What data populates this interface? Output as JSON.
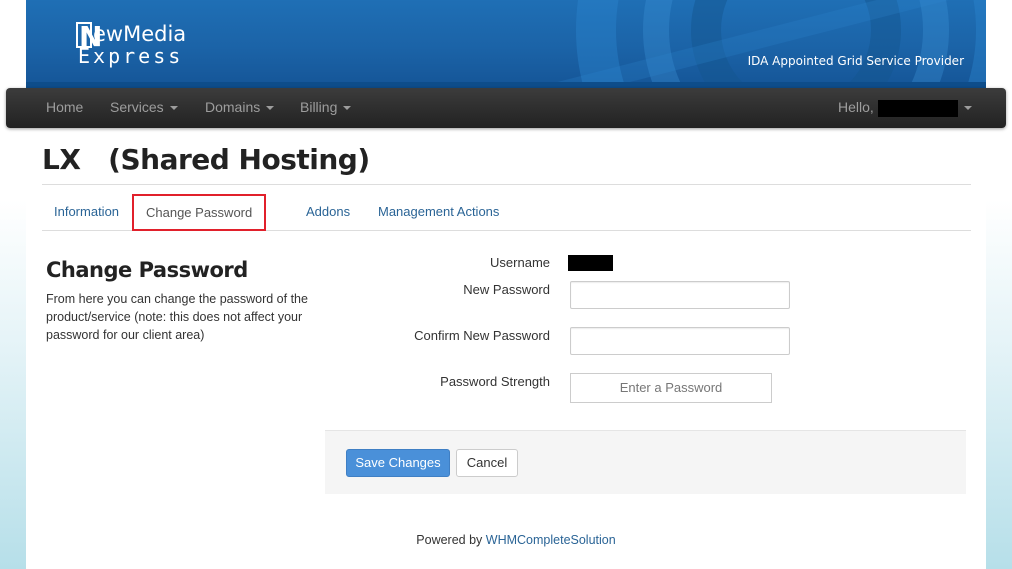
{
  "header": {
    "logo_line1_rest": "ewMedia",
    "logo_line1_initial": "N",
    "logo_line2": "Express",
    "tagline": "IDA Appointed Grid Service Provider"
  },
  "navbar": {
    "items": [
      {
        "label": "Home"
      },
      {
        "label": "Services"
      },
      {
        "label": "Domains"
      },
      {
        "label": "Billing"
      }
    ],
    "hello_label": "Hello,"
  },
  "page": {
    "title": "LX   (Shared Hosting)"
  },
  "tabs": [
    {
      "label": "Information"
    },
    {
      "label": "Change Password"
    },
    {
      "label": "Addons"
    },
    {
      "label": "Management Actions"
    }
  ],
  "change_password": {
    "heading": "Change Password",
    "description": "From here you can change the password of the product/service (note: this does not affect your password for our client area)",
    "username_label": "Username",
    "new_password_label": "New Password",
    "confirm_password_label": "Confirm New Password",
    "strength_label": "Password Strength",
    "strength_value": "Enter a Password",
    "save_label": "Save Changes",
    "cancel_label": "Cancel"
  },
  "footer": {
    "powered_by": "Powered by",
    "link": "WHMCompleteSolution"
  },
  "colors": {
    "banner": "#1b63a7",
    "navbar": "#222222",
    "link": "#2a6496",
    "primary_button": "#4a90d9",
    "active_tab_highlight": "#e1202b"
  }
}
